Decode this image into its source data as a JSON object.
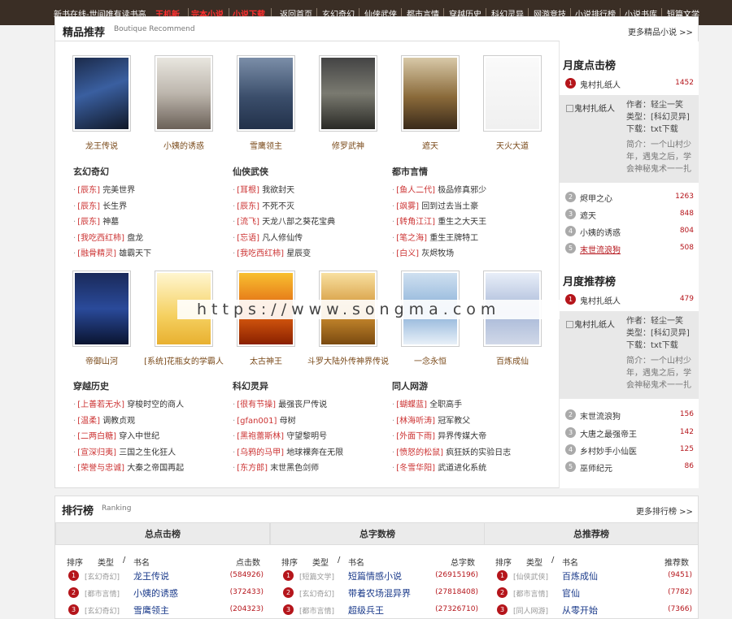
{
  "topbar": {
    "site_title": "新书在线-世间唯有读书高",
    "hot_links": [
      "王机新",
      "完本小说",
      "小说下载"
    ],
    "nav": [
      "返回首页",
      "玄幻奇幻",
      "仙侠武侠",
      "都市言情",
      "穿越历史",
      "科幻灵异",
      "网游竞技",
      "小说排行榜",
      "小说书库",
      "短篇文学"
    ]
  },
  "recommend": {
    "title": "精品推荐",
    "subtitle": "Boutique Recommend",
    "more": "更多精品小说 >>",
    "row1": [
      {
        "name": "龙王传说"
      },
      {
        "name": "小姨的诱惑"
      },
      {
        "name": "雪鹰领主"
      },
      {
        "name": "修罗武神"
      },
      {
        "name": "遮天"
      },
      {
        "name": "天火大道"
      }
    ],
    "row2": [
      {
        "name": "帝御山河"
      },
      {
        "name": "[系统]花瓶女的学霸人"
      },
      {
        "name": "太古神王"
      },
      {
        "name": "斗罗大陆外传神界传说"
      },
      {
        "name": "一念永恒"
      },
      {
        "name": "百炼成仙"
      }
    ],
    "categories1": [
      {
        "title": "玄幻奇幻",
        "items": [
          [
            "辰东",
            "完美世界"
          ],
          [
            "辰东",
            "长生界"
          ],
          [
            "辰东",
            "神墓"
          ],
          [
            "我吃西红柿",
            "盘龙"
          ],
          [
            "融骨精灵",
            "雄霸天下"
          ]
        ]
      },
      {
        "title": "仙侠武侠",
        "items": [
          [
            "耳根",
            "我欲封天"
          ],
          [
            "辰东",
            "不死不灭"
          ],
          [
            "流飞",
            "天龙八部之葵花宝典"
          ],
          [
            "忘语",
            "凡人修仙传"
          ],
          [
            "我吃西红柿",
            "星辰变"
          ]
        ]
      },
      {
        "title": "都市言情",
        "items": [
          [
            "鱼人二代",
            "极品修真邪少"
          ],
          [
            "飒雾",
            "回到过去当土豪"
          ],
          [
            "转角江江",
            "重生之大天王"
          ],
          [
            "笔之海",
            "重生王牌特工"
          ],
          [
            "白义",
            "灰烬牧场"
          ]
        ]
      }
    ],
    "categories2": [
      {
        "title": "穿越历史",
        "items": [
          [
            "上善若无水",
            "穿梭时空的商人"
          ],
          [
            "温柔",
            "调教贞观"
          ],
          [
            "二两白糖",
            "穿入中世纪"
          ],
          [
            "宣深归夷",
            "三国之生化狂人"
          ],
          [
            "荣誉与忠诚",
            "大秦之帝国再起"
          ]
        ]
      },
      {
        "title": "科幻灵异",
        "items": [
          [
            "很有节操",
            "最强丧尸传说"
          ],
          [
            "gfan001",
            "母树"
          ],
          [
            "黑袍蕾斯林",
            "守望黎明号"
          ],
          [
            "乌鸦的马甲",
            "地球裸奔在无限"
          ],
          [
            "东方郎",
            "末世黑色剑师"
          ]
        ]
      },
      {
        "title": "同人网游",
        "items": [
          [
            "蝴蝶蓝",
            "全职高手"
          ],
          [
            "林海听涛",
            "冠军教父"
          ],
          [
            "外面下雨",
            "异界传媒大帝"
          ],
          [
            "愤怒的松鼠",
            "疯狂妖的实验日志"
          ],
          [
            "冬雪华阳",
            "武道进化系统"
          ]
        ]
      }
    ]
  },
  "sidebar": {
    "monthly_click": {
      "title": "月度点击榜",
      "top": {
        "name": "鬼村扎纸人",
        "count": "1452"
      },
      "detail": {
        "cover_alt": "鬼村扎纸人",
        "author": "作者：轻尘一笑",
        "type": "类型：[科幻灵异]",
        "download": "下载：txt下载",
        "desc": "简介：一个山村少年，遇鬼之后，学会神秘鬼术一一扎"
      },
      "rest": [
        {
          "rank": "2",
          "name": "烬甲之心",
          "count": "1263"
        },
        {
          "rank": "3",
          "name": "遮天",
          "count": "848"
        },
        {
          "rank": "4",
          "name": "小姨的诱惑",
          "count": "804"
        },
        {
          "rank": "5",
          "name": "末世流浪狗",
          "count": "508"
        }
      ]
    },
    "monthly_recommend": {
      "title": "月度推荐榜",
      "top": {
        "name": "鬼村扎纸人",
        "count": "479"
      },
      "detail": {
        "cover_alt": "鬼村扎纸人",
        "author": "作者：轻尘一笑",
        "type": "类型：[科幻灵异]",
        "download": "下载：txt下载",
        "desc": "简介：一个山村少年，遇鬼之后，学会神秘鬼术一一扎"
      },
      "rest": [
        {
          "rank": "2",
          "name": "末世流浪狗",
          "count": "156"
        },
        {
          "rank": "3",
          "name": "大唐之最强帝王",
          "count": "142"
        },
        {
          "rank": "4",
          "name": "乡村妙手小仙医",
          "count": "125"
        },
        {
          "rank": "5",
          "name": "巫师纪元",
          "count": "86"
        }
      ]
    }
  },
  "ranking": {
    "title": "排行榜",
    "subtitle": "Ranking",
    "more": "更多排行榜 >>",
    "columns": [
      {
        "title": "总点击榜",
        "headers": {
          "rank": "排序",
          "type": "类型",
          "slash": "/",
          "name": "书名",
          "metric": "点击数"
        },
        "rows": [
          {
            "rank": "1",
            "type": "[玄幻奇幻]",
            "name": "龙王传说",
            "value": "(584926)"
          },
          {
            "rank": "2",
            "type": "[都市言情]",
            "name": "小姨的诱惑",
            "value": "(372433)"
          },
          {
            "rank": "3",
            "type": "[玄幻奇幻]",
            "name": "雪鹰领主",
            "value": "(204323)"
          }
        ]
      },
      {
        "title": "总字数榜",
        "headers": {
          "rank": "排序",
          "type": "类型",
          "slash": "/",
          "name": "书名",
          "metric": "总字数"
        },
        "rows": [
          {
            "rank": "1",
            "type": "[短篇文学]",
            "name": "短篇情感小说",
            "value": "(26915196)"
          },
          {
            "rank": "2",
            "type": "[玄幻奇幻]",
            "name": "带着农场混异界",
            "value": "(27818408)"
          },
          {
            "rank": "3",
            "type": "[都市言情]",
            "name": "超级兵王",
            "value": "(27326710)"
          }
        ]
      },
      {
        "title": "总推荐榜",
        "headers": {
          "rank": "排序",
          "type": "类型",
          "slash": "/",
          "name": "书名",
          "metric": "推荐数"
        },
        "rows": [
          {
            "rank": "1",
            "type": "[仙侠武侠]",
            "name": "百炼成仙",
            "value": "(9451)"
          },
          {
            "rank": "2",
            "type": "[都市言情]",
            "name": "官仙",
            "value": "(7782)"
          },
          {
            "rank": "3",
            "type": "[同人网游]",
            "name": "从零开始",
            "value": "(7366)"
          }
        ]
      }
    ]
  },
  "watermark": "https://www.songma.com",
  "colors": {
    "topbar": "#3a2e25",
    "accent_red": "#b5151b",
    "book_name": "#7a4a1a",
    "rank_link": "#1a3a8a"
  }
}
